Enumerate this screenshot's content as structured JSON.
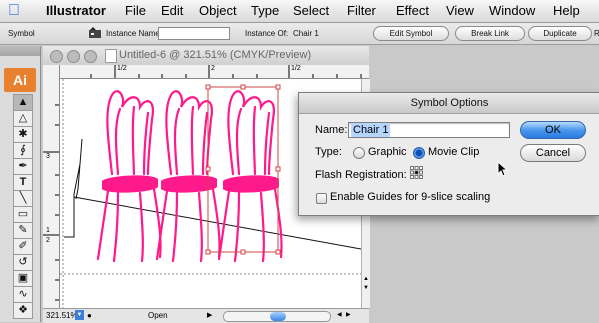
{
  "menubar": {
    "app_name": "Illustrator",
    "items": [
      "File",
      "Edit",
      "Object",
      "Type",
      "Select",
      "Filter",
      "Effect",
      "View",
      "Window",
      "Help"
    ]
  },
  "controlbar": {
    "symbol_label": "Symbol",
    "instance_name_label": "Instance Name:",
    "instance_name_value": "",
    "instance_of_label": "Instance Of:",
    "instance_of_value": "Chair 1",
    "edit_symbol": "Edit Symbol",
    "break_link": "Break Link",
    "duplicate": "Duplicate",
    "cut_off_text": "R"
  },
  "tools": {
    "logo": "Ai",
    "items": [
      "selection-tool",
      "direct-selection-tool",
      "magic-wand-tool",
      "lasso-tool",
      "pen-tool",
      "type-tool",
      "line-tool",
      "rectangle-tool",
      "paintbrush-tool",
      "pencil-tool",
      "rotate-tool",
      "scale-tool",
      "warp-tool",
      "symbol-sprayer-tool",
      "graph-tool"
    ]
  },
  "document": {
    "title": "Untitled-6 @ 321.51% (CMYK/Preview)",
    "ruler_top": [
      "1/2",
      "2",
      "1/2"
    ],
    "ruler_left": [
      "3",
      "1",
      "2"
    ],
    "zoom": "321.51%",
    "status": "Open",
    "chair_color": "#ff1a8c",
    "selection_color": "#e05050"
  },
  "dialog": {
    "title": "Symbol Options",
    "name_label": "Name:",
    "name_value": "Chair 1",
    "type_label": "Type:",
    "type_options": [
      "Graphic",
      "Movie Clip"
    ],
    "type_selected": "Movie Clip",
    "registration_label": "Flash Registration:",
    "guides_label": "Enable Guides for 9-slice scaling",
    "guides_checked": false,
    "ok_label": "OK",
    "cancel_label": "Cancel"
  }
}
